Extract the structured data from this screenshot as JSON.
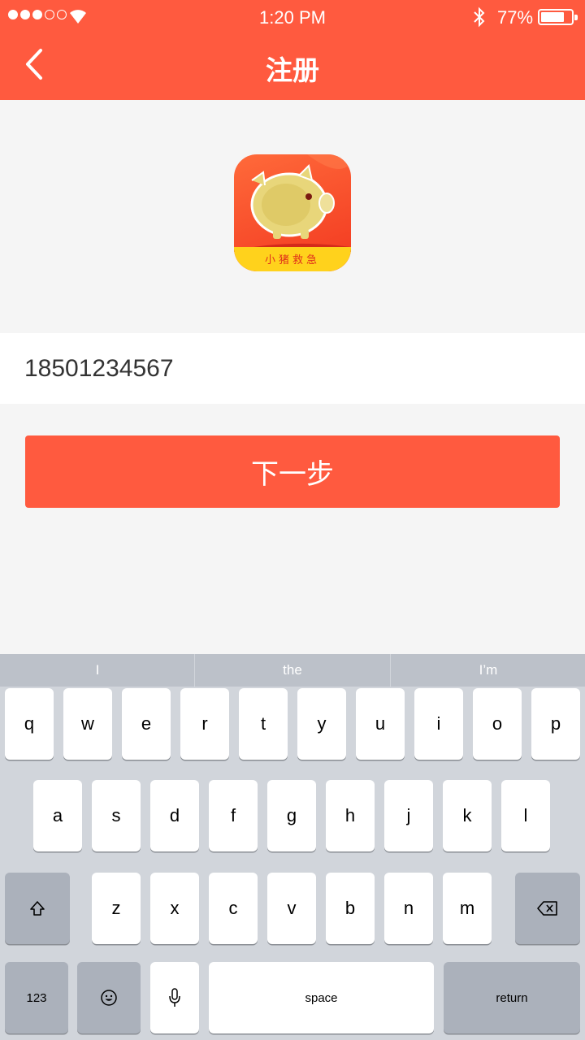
{
  "status_bar": {
    "time": "1:20 PM",
    "battery": "77%",
    "battery_fraction": 0.77
  },
  "nav": {
    "title": "注册"
  },
  "app_icon": {
    "label": "小猪救急"
  },
  "form": {
    "phone_value": "18501234567"
  },
  "next_button": {
    "label": "下一步"
  },
  "keyboard": {
    "suggestions": [
      "I",
      "the",
      "I’m"
    ],
    "row1": [
      "q",
      "w",
      "e",
      "r",
      "t",
      "y",
      "u",
      "i",
      "o",
      "p"
    ],
    "row2": [
      "a",
      "s",
      "d",
      "f",
      "g",
      "h",
      "j",
      "k",
      "l"
    ],
    "row3": [
      "z",
      "x",
      "c",
      "v",
      "b",
      "n",
      "m"
    ],
    "numbers_key": "123",
    "space_key": "space",
    "return_key": "return"
  },
  "colors": {
    "accent": "#ff5a3f",
    "background": "#f5f5f5",
    "keyboard": "#d1d5db"
  }
}
